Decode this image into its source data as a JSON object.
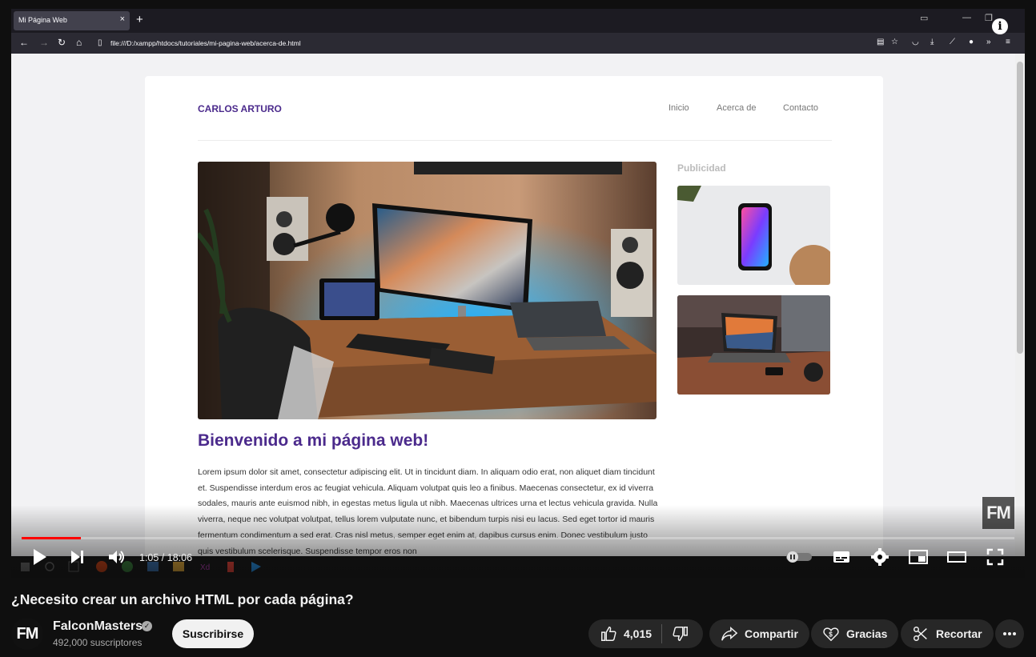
{
  "browser": {
    "tab_title": "Mi Página Web",
    "tab_close": "×",
    "new_tab": "+",
    "url": "file:///D:/xampp/htdocs/tutoriales/mi-pagina-web/acerca-de.html"
  },
  "site": {
    "brand": "CARLOS ARTURO",
    "nav": [
      "Inicio",
      "Acerca de",
      "Contacto"
    ],
    "heading": "Bienvenido a mi página web!",
    "body_text": "Lorem ipsum dolor sit amet, consectetur adipiscing elit. Ut in tincidunt diam. In aliquam odio erat, non aliquet diam tincidunt et. Suspendisse interdum eros ac feugiat vehicula. Aliquam volutpat quis leo a finibus. Maecenas consectetur, ex id viverra sodales, mauris ante euismod nibh, in egestas metus ligula ut nibh. Maecenas ultrices urna et lectus vehicula gravida. Nulla viverra, neque nec volutpat volutpat, tellus lorem vulputate nunc, et bibendum turpis nisi eu lacus. Sed eget tortor id mauris fermentum condimentum a sed erat. Cras nisl metus, semper eget enim at, dapibus cursus enim. Donec vestibulum justo quis vestibulum scelerisque. Suspendisse tempor eros non",
    "sidebar_title": "Publicidad"
  },
  "player": {
    "watermark": "FM",
    "time": "1:05 / 18:06",
    "progress_fraction": 0.06
  },
  "video": {
    "title": "¿Necesito crear un archivo HTML por cada página?",
    "channel_logo": "FM",
    "channel_name": "FalconMasters",
    "subscribers": "492,000 suscriptores",
    "subscribe_label": "Suscribirse",
    "likes": "4,015",
    "share_label": "Compartir",
    "thanks_label": "Gracias",
    "clip_label": "Recortar"
  },
  "colors": {
    "accent_purple": "#4b2a8c",
    "progress_red": "#ff0000",
    "page_bg": "#0f0f0f"
  }
}
